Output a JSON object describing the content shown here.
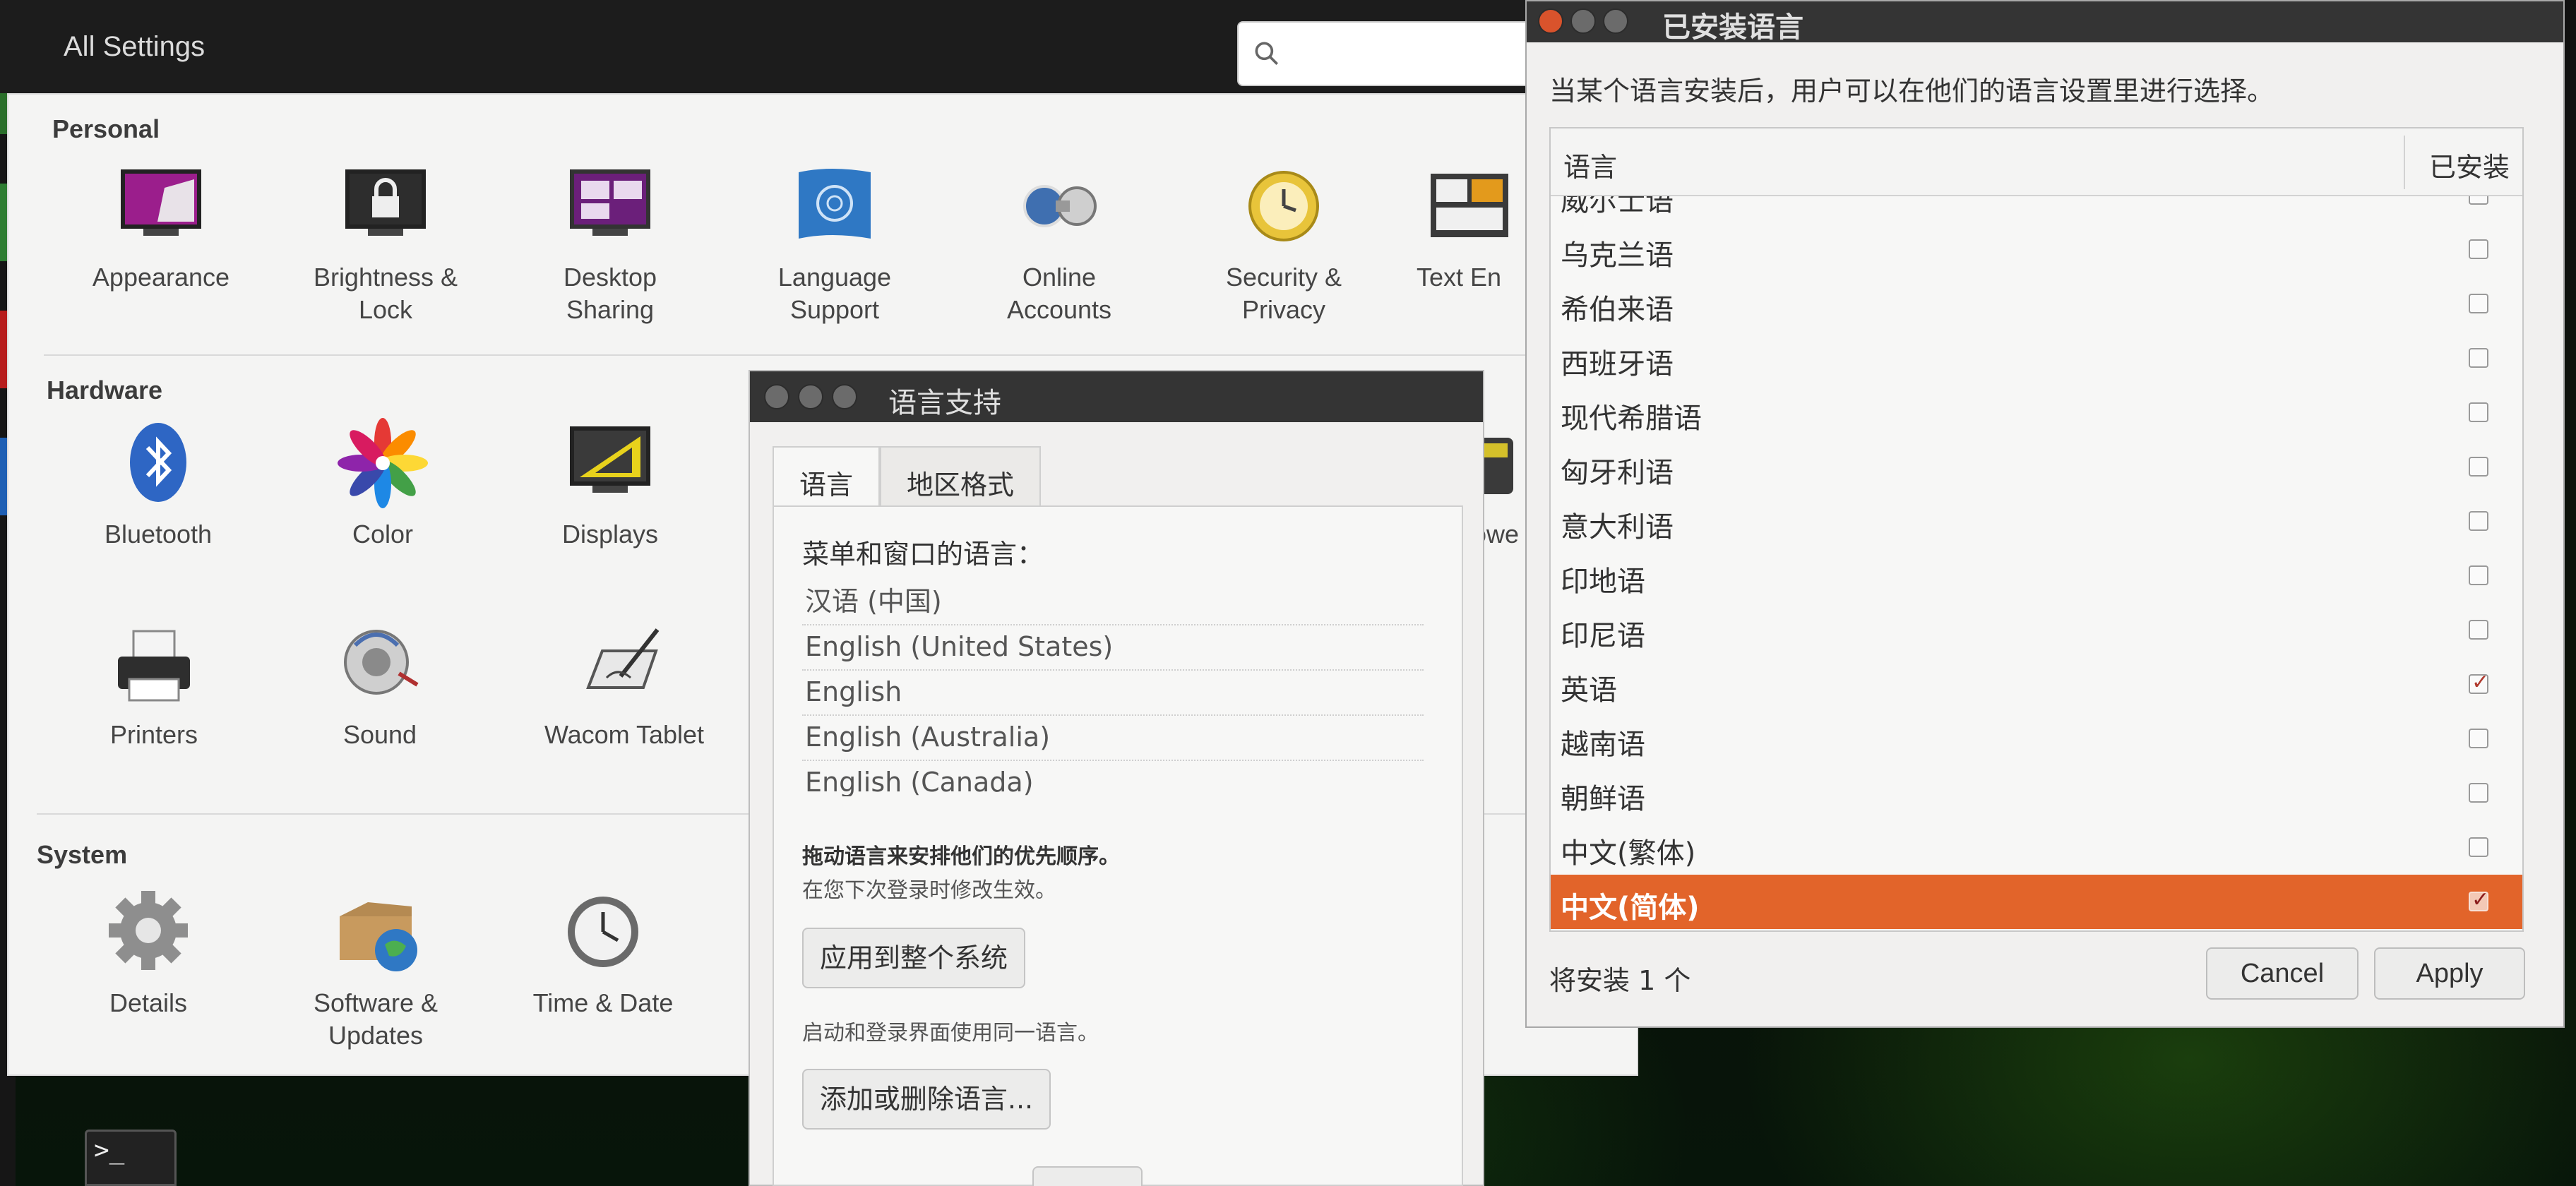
{
  "topbar": {
    "title": "All Settings"
  },
  "settings": {
    "sections": {
      "personal": "Personal",
      "hardware": "Hardware",
      "system": "System"
    },
    "personal_items": [
      {
        "line1": "Appearance",
        "line2": "",
        "icon": "appearance-icon"
      },
      {
        "line1": "Brightness &",
        "line2": "Lock",
        "icon": "lock-icon"
      },
      {
        "line1": "Desktop",
        "line2": "Sharing",
        "icon": "desktop-sharing-icon"
      },
      {
        "line1": "Language",
        "line2": "Support",
        "icon": "language-flag-icon"
      },
      {
        "line1": "Online",
        "line2": "Accounts",
        "icon": "online-accounts-icon"
      },
      {
        "line1": "Security &",
        "line2": "Privacy",
        "icon": "security-clock-icon"
      },
      {
        "line1": "Text En",
        "line2": "",
        "icon": "text-entry-icon"
      }
    ],
    "hardware_items": [
      {
        "line1": "Bluetooth",
        "icon": "bluetooth-icon"
      },
      {
        "line1": "Color",
        "icon": "color-icon"
      },
      {
        "line1": "Displays",
        "icon": "displays-icon"
      },
      {
        "line1": "owe",
        "icon": "power-icon"
      },
      {
        "line1": "Printers",
        "icon": "printer-icon"
      },
      {
        "line1": "Sound",
        "icon": "sound-icon"
      },
      {
        "line1": "Wacom Tablet",
        "icon": "wacom-tablet-icon"
      }
    ],
    "system_items": [
      {
        "line1": "Details",
        "line2": "",
        "icon": "gear-icon"
      },
      {
        "line1": "Software &",
        "line2": "Updates",
        "icon": "software-updates-icon"
      },
      {
        "line1": "Time & Date",
        "line2": "",
        "icon": "clock-icon"
      }
    ]
  },
  "language_support": {
    "title": "语言支持",
    "tabs": [
      "语言",
      "地区格式"
    ],
    "menu_lang_label": "菜单和窗口的语言：",
    "languages": [
      "汉语 (中国)",
      "English (United States)",
      "English",
      "English (Australia)",
      "English (Canada)"
    ],
    "drag_hint": "拖动语言来安排他们的优先顺序。",
    "effect_hint": "在您下次登录时修改生效。",
    "apply_system_button": "应用到整个系统",
    "same_lang_hint": "启动和登录界面使用同一语言。",
    "add_remove_button": "添加或删除语言..."
  },
  "installed_languages": {
    "title": "已安装语言",
    "description": "当某个语言安装后，用户可以在他们的语言设置里进行选择。",
    "col_language": "语言",
    "col_installed": "已安装",
    "rows": [
      {
        "name": "威尔士语",
        "installed": false
      },
      {
        "name": "乌克兰语",
        "installed": false
      },
      {
        "name": "希伯来语",
        "installed": false
      },
      {
        "name": "西班牙语",
        "installed": false
      },
      {
        "name": "现代希腊语",
        "installed": false
      },
      {
        "name": "匈牙利语",
        "installed": false
      },
      {
        "name": "意大利语",
        "installed": false
      },
      {
        "name": "印地语",
        "installed": false
      },
      {
        "name": "印尼语",
        "installed": false
      },
      {
        "name": "英语",
        "installed": true
      },
      {
        "name": "越南语",
        "installed": false
      },
      {
        "name": "朝鲜语",
        "installed": false
      },
      {
        "name": "中文(繁体)",
        "installed": false
      },
      {
        "name": "中文(简体)",
        "installed": true,
        "selected": true
      }
    ],
    "footer": "将安装 1 个",
    "cancel_button": "Cancel",
    "apply_button": "Apply"
  },
  "colors": {
    "selection": "#e2642a",
    "titlebar": "#343434",
    "checkmark": "#b03a2e"
  }
}
